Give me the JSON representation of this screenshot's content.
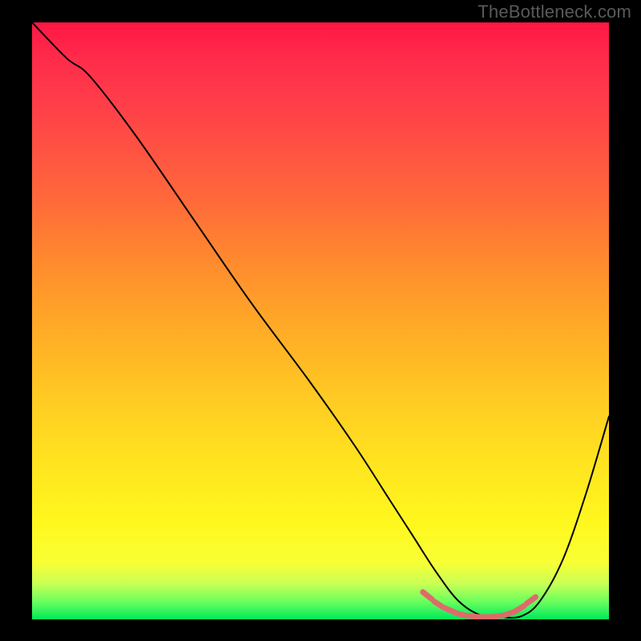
{
  "watermark": "TheBottleneck.com",
  "chart_data": {
    "type": "line",
    "title": "",
    "xlabel": "",
    "ylabel": "",
    "xlim": [
      0,
      100
    ],
    "ylim": [
      0,
      100
    ],
    "grid": false,
    "legend": false,
    "series": [
      {
        "name": "bottleneck-curve",
        "color": "#000000",
        "x": [
          0,
          6,
          10,
          18,
          28,
          38,
          48,
          56,
          62,
          66,
          70,
          74,
          78,
          82,
          85,
          88,
          92,
          96,
          100
        ],
        "y": [
          100,
          94,
          91,
          81,
          67,
          53,
          40,
          29,
          20,
          14,
          8,
          3,
          0.6,
          0.3,
          0.6,
          3,
          10,
          21,
          34
        ]
      },
      {
        "name": "highlight-band",
        "color": "#dd6b6b",
        "x": [
          68.5,
          70.5,
          72.5,
          74.5,
          76.5,
          78.5,
          80.5,
          82.5,
          84.5,
          86.5
        ],
        "y": [
          4.0,
          2.5,
          1.5,
          0.8,
          0.5,
          0.4,
          0.5,
          0.9,
          1.8,
          3.2
        ]
      }
    ],
    "gradient_stops": [
      {
        "pos": 0,
        "color": "#ff1744"
      },
      {
        "pos": 0.2,
        "color": "#ff4f44"
      },
      {
        "pos": 0.4,
        "color": "#ff8a2e"
      },
      {
        "pos": 0.62,
        "color": "#ffc823"
      },
      {
        "pos": 0.84,
        "color": "#fff81e"
      },
      {
        "pos": 0.94,
        "color": "#c9ff55"
      },
      {
        "pos": 1.0,
        "color": "#00e85c"
      }
    ]
  }
}
